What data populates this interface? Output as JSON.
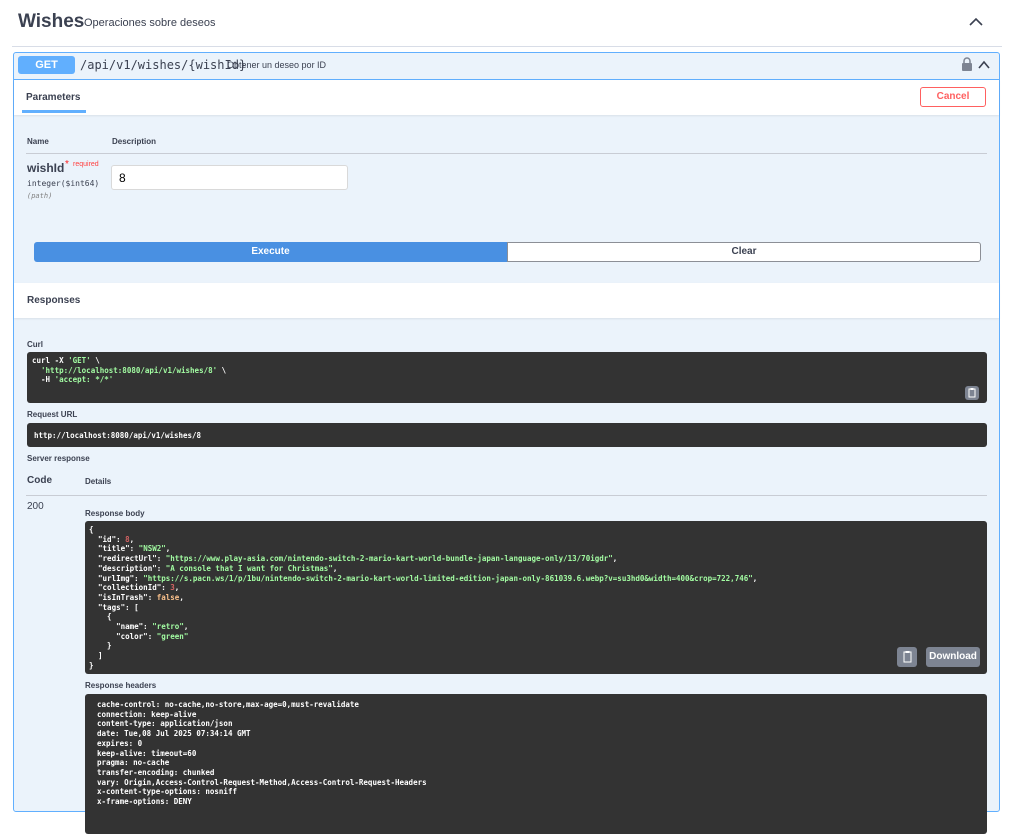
{
  "tag": {
    "title": "Wishes",
    "description": "Operaciones sobre deseos"
  },
  "operation": {
    "method": "GET",
    "path": "/api/v1/wishes/{wishId}",
    "summary": "Obtener un deseo por ID"
  },
  "parameters": {
    "tab_label": "Parameters",
    "cancel_label": "Cancel",
    "col_name": "Name",
    "col_description": "Description",
    "items": [
      {
        "name": "wishId",
        "required_star": "*",
        "required_label": "required",
        "type": "integer($int64)",
        "in": "(path)",
        "value": "8"
      }
    ]
  },
  "actions": {
    "execute_label": "Execute",
    "clear_label": "Clear"
  },
  "responses": {
    "title": "Responses",
    "curl_label": "Curl",
    "curl_lines": [
      "curl -X 'GET' \\",
      "  'http://localhost:8080/api/v1/wishes/8' \\",
      "  -H 'accept: */*'"
    ],
    "request_url_label": "Request URL",
    "request_url": "http://localhost:8080/api/v1/wishes/8",
    "server_response_label": "Server response",
    "col_code": "Code",
    "col_details": "Details",
    "code": "200",
    "body_label": "Response body",
    "body": {
      "id": 8,
      "title": "NSW2",
      "redirectUrl": "https://www.play-asia.com/nintendo-switch-2-mario-kart-world-bundle-japan-language-only/13/70igdr",
      "description": "A console that I want for Christmas",
      "urlImg": "https://s.pacn.ws/1/p/1bu/nintendo-switch-2-mario-kart-world-limited-edition-japan-only-861039.6.webp?v=su3hd0&width=400&crop=722,746",
      "collectionId": 3,
      "isInTrash": false,
      "tags": [
        {
          "name": "retro",
          "color": "green"
        }
      ]
    },
    "download_label": "Download",
    "headers_label": "Response headers",
    "headers": [
      "cache-control: no-cache,no-store,max-age=0,must-revalidate",
      "connection: keep-alive",
      "content-type: application/json",
      "date: Tue,08 Jul 2025 07:34:14 GMT",
      "expires: 0",
      "keep-alive: timeout=60",
      "pragma: no-cache",
      "transfer-encoding: chunked",
      "vary: Origin,Access-Control-Request-Method,Access-Control-Request-Headers",
      "x-content-type-options: nosniff",
      "x-frame-options: DENY"
    ]
  },
  "icons": {
    "collapse": "chevron-up-icon",
    "lock": "lock-icon",
    "copy": "copy-icon"
  }
}
